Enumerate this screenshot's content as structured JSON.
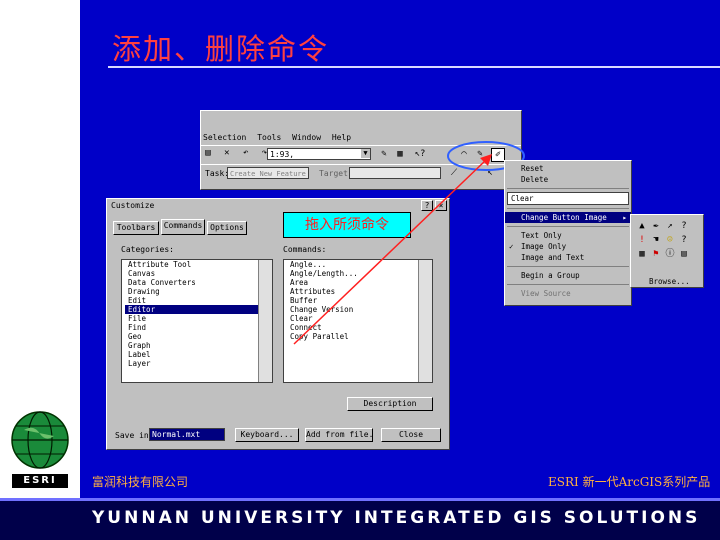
{
  "slide": {
    "title": "添加、删除命令",
    "company": "富润科技有限公司",
    "product": "ESRI 新一代ArcGIS系列产品",
    "footer": "YUNNAN UNIVERSITY INTEGRATED GIS SOLUTIONS",
    "logo_text": "ESRI"
  },
  "app_window": {
    "menu": [
      "Selection",
      "Tools",
      "Window",
      "Help"
    ],
    "scale_value": "1:93,",
    "task_label": "Task:",
    "task_value": "Create New Feature",
    "target_label": "Target:"
  },
  "callout": {
    "text": "拖入所须命令"
  },
  "customize": {
    "title": "Customize",
    "tabs": [
      "Toolbars",
      "Commands",
      "Options"
    ],
    "categories_label": "Categories:",
    "commands_label": "Commands:",
    "categories": [
      "Attribute Tool",
      "Canvas",
      "Data Converters",
      "Drawing",
      "Edit",
      "Editor",
      "File",
      "Find",
      "Geo",
      "Graph",
      "Label",
      "Layer"
    ],
    "selected_category": "Editor",
    "commands": [
      "Angle...",
      "Angle/Length...",
      "Area",
      "Attributes",
      "Buffer",
      "Change Version",
      "Clear",
      "Connect",
      "Copy Parallel"
    ],
    "description_button": "Description",
    "save_label": "Save in:",
    "save_value": "Normal.mxt",
    "keyboard_button": "Keyboard...",
    "add_from_file_button": "Add from file...",
    "close_button": "Close"
  },
  "context_menu": {
    "items": [
      "Reset",
      "Delete",
      "Clear",
      "Change Button Image",
      "Text Only",
      "Image Only",
      "Image and Text",
      "Begin a Group",
      "View Source"
    ],
    "highlighted": "Change Button Image",
    "checked": "Image Only"
  },
  "icon_picker": {
    "browse_label": "Browse..."
  },
  "colors": {
    "slide_bg": "#0000c8",
    "title": "#ff4040",
    "accent": "#ffb040",
    "callout_bg": "#00ffff"
  }
}
